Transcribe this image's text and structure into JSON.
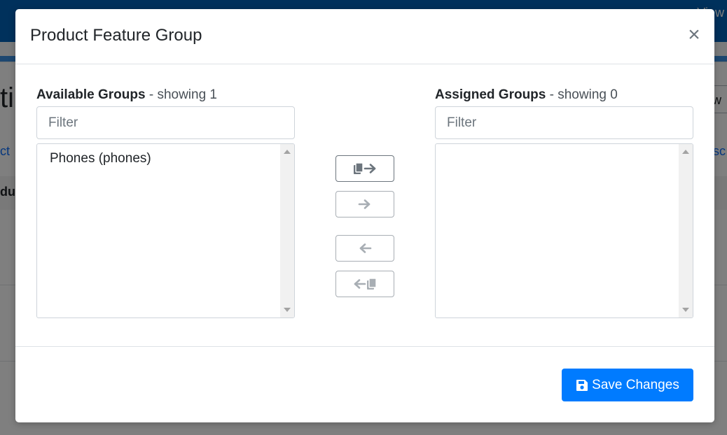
{
  "modal": {
    "title": "Product Feature Group",
    "close_label": "×"
  },
  "available": {
    "label_bold": "Available Groups",
    "label_suffix": " - showing 1",
    "filter_placeholder": "Filter",
    "filter_value": "",
    "options": [
      "Phones (phones)"
    ]
  },
  "assigned": {
    "label_bold": "Assigned Groups",
    "label_suffix": " - showing 0",
    "filter_placeholder": "Filter",
    "filter_value": "",
    "options": []
  },
  "transfer_buttons": [
    {
      "name": "move-all-right",
      "icon": "copy-arrow-right-icon",
      "enabled": true
    },
    {
      "name": "move-selected-right",
      "icon": "arrow-right-icon",
      "enabled": false
    },
    {
      "name": "move-selected-left",
      "icon": "arrow-left-icon",
      "enabled": false
    },
    {
      "name": "move-all-left",
      "icon": "arrow-left-copy-icon",
      "enabled": false
    }
  ],
  "footer": {
    "save_label": "Save Changes",
    "save_icon": "floppy-disk-icon"
  },
  "background": {
    "topbar_text": "View",
    "heading_fragment": "ti",
    "right_button_fragment": "w",
    "left_link_fragment": "ct",
    "right_link_fragment": "sc",
    "row_text_fragment": "du"
  },
  "colors": {
    "primary": "#007bff",
    "topbar": "#0062b8",
    "border": "#ced4da",
    "muted_icon": "#6c757d"
  }
}
